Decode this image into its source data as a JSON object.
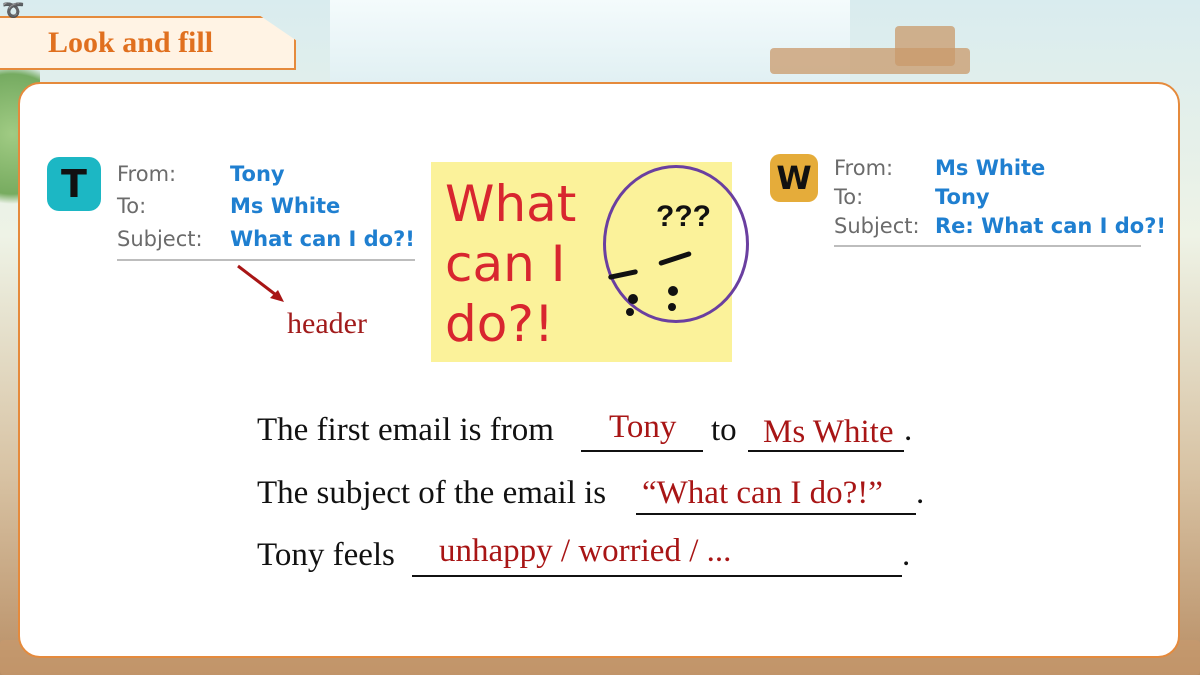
{
  "title": "Look and fill",
  "email_left": {
    "avatar_letter": "T",
    "avatar_color": "#1cb7c4",
    "rows": [
      {
        "label": "From:",
        "value": "Tony"
      },
      {
        "label": "To:",
        "value": "Ms White"
      },
      {
        "label": "Subject:",
        "value": "What can I do?!"
      }
    ]
  },
  "email_right": {
    "avatar_letter": "W",
    "avatar_color": "#e5ac3a",
    "rows": [
      {
        "label": "From:",
        "value": "Ms White"
      },
      {
        "label": "To:",
        "value": "Tony"
      },
      {
        "label": "Subject:",
        "value": "Re: What can I do?!"
      }
    ]
  },
  "header_label": "header",
  "note": {
    "lines": [
      "What",
      "can I",
      "do?!"
    ],
    "face_marks": "???"
  },
  "sentences": [
    {
      "before": "The first email is from",
      "answer1": "Tony",
      "mid": "to",
      "answer2": "Ms White",
      "after": "."
    },
    {
      "before": "The subject of the email is",
      "answer": "“What can I do?!”",
      "after": "."
    },
    {
      "before": "Tony feels",
      "answer": "unhappy / worried / ...",
      "after": "."
    }
  ],
  "colors": {
    "accent": "#e58a3c",
    "answer": "#a81515",
    "link": "#1f7fd0"
  }
}
